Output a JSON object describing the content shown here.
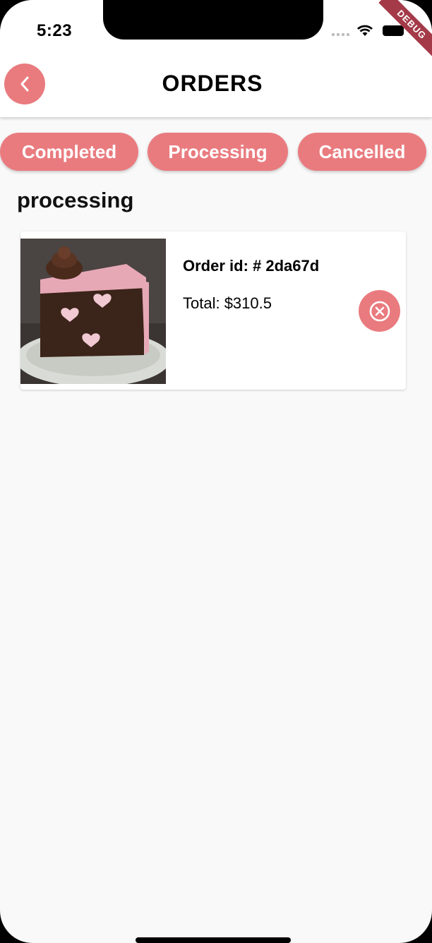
{
  "status_bar": {
    "time": "5:23",
    "debug_banner": "DEBUG"
  },
  "header": {
    "title": "ORDERS",
    "back_icon": "chevron-left-icon"
  },
  "filters": {
    "completed": "Completed",
    "processing": "Processing",
    "cancelled": "Cancelled"
  },
  "section": {
    "title": "processing"
  },
  "orders": [
    {
      "id_label": "Order id: # 2da67d",
      "total_label": "Total: $310.5",
      "image": "chocolate-cake-slice-image",
      "action_icon": "cancel-circle-icon"
    }
  ],
  "colors": {
    "accent": "#e97b7f",
    "background": "#f9f9f9"
  }
}
